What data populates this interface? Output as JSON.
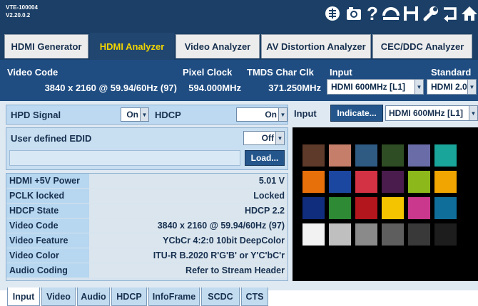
{
  "device": {
    "model": "VTE-100004",
    "version": "V2.20.0.2"
  },
  "toolbar": {
    "icons": [
      "brain-icon",
      "camera-icon",
      "help-icon",
      "refresh-icon",
      "save-icon",
      "wrench-icon",
      "return-icon",
      "home-icon"
    ],
    "help_glyph": "?"
  },
  "tabs": [
    {
      "label": "HDMI Generator",
      "active": false
    },
    {
      "label": "HDMI Analyzer",
      "active": true
    },
    {
      "label": "Video Analyzer",
      "active": false
    },
    {
      "label": "AV Distortion Analyzer",
      "active": false
    },
    {
      "label": "CEC/DDC Analyzer",
      "active": false
    }
  ],
  "info": {
    "video_code_label": "Video Code",
    "video_code_value": "3840 x 2160 @ 59.94/60Hz (97)",
    "pixel_clock_label": "Pixel Clock",
    "pixel_clock_value": "594.000MHz",
    "tmds_label": "TMDS Char Clk",
    "tmds_value": "371.250MHz",
    "input_label": "Input",
    "input_value": "HDMI 600MHz [L1]",
    "standard_label": "Standard",
    "standard_value": "HDMI 2.0"
  },
  "hpd": {
    "label": "HPD Signal",
    "value": "On",
    "hdcp_label": "HDCP",
    "hdcp_value": "On"
  },
  "input_panel": {
    "label": "Input",
    "indicate_label": "Indicate...",
    "source_value": "HDMI 600MHz [L1]"
  },
  "edid": {
    "label": "User defined EDID",
    "value": "Off",
    "load_label": "Load..."
  },
  "status": [
    {
      "key": "HDMI +5V Power",
      "value": "5.01 V"
    },
    {
      "key": "PCLK locked",
      "value": "Locked"
    },
    {
      "key": "HDCP State",
      "value": "HDCP 2.2"
    },
    {
      "key": "Video Code",
      "value": "3840 x 2160 @ 59.94/60Hz (97)"
    },
    {
      "key": "Video Feature",
      "value": "YCbCr 4:2:0  10bit DeepColor"
    },
    {
      "key": "Video Color",
      "value": "ITU-R B.2020 R'G'B' or Y'C'bC'r"
    },
    {
      "key": "Audio Coding",
      "value": "Refer to Stream Header"
    }
  ],
  "color_checker": [
    [
      "#5e3a2b",
      "#c47e6a",
      "#2f5a82",
      "#2f4d24",
      "#6a6ca8",
      "#1aa59b"
    ],
    [
      "#e8700b",
      "#1c47a0",
      "#d23243",
      "#4a1c4d",
      "#8cb81b",
      "#f0a500"
    ],
    [
      "#102d7d",
      "#2e8a34",
      "#b3161c",
      "#f4c400",
      "#c9388c",
      "#0f6f9a"
    ],
    [
      "#f2f2f2",
      "#bfbfbf",
      "#8a8a8a",
      "#5e5e5e",
      "#393939",
      "#1d1d1d"
    ]
  ],
  "bottom_tabs": [
    {
      "label": "Input",
      "active": true
    },
    {
      "label": "Video",
      "active": false
    },
    {
      "label": "Audio",
      "active": false
    },
    {
      "label": "HDCP",
      "active": false
    },
    {
      "label": "InfoFrame",
      "active": false
    },
    {
      "label": "SCDC",
      "active": false
    },
    {
      "label": "CTS",
      "active": false
    }
  ]
}
